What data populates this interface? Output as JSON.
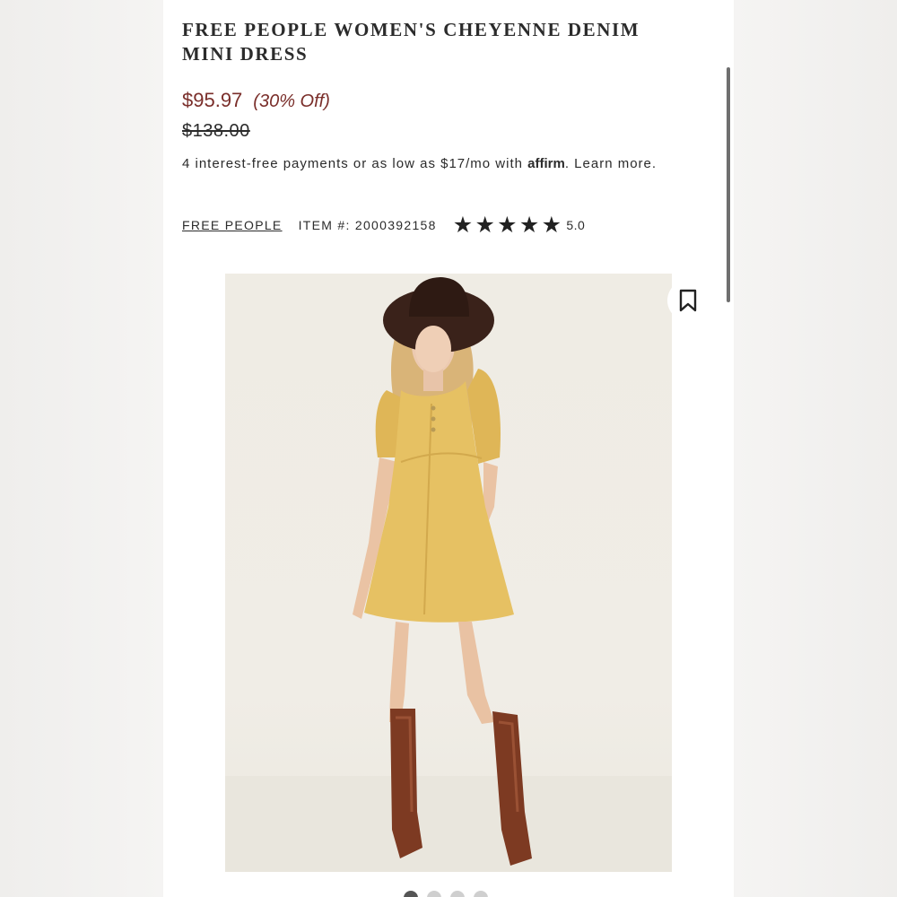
{
  "product": {
    "title": "FREE PEOPLE WOMEN'S CHEYENNE DENIM MINI DRESS",
    "sale_price": "$95.97",
    "discount": "(30% Off)",
    "original_price": "$138.00",
    "financing_text_before": "4 interest-free payments or as low as $17/mo with",
    "financing_logo": "affirm",
    "financing_text_after": ". Learn more.",
    "brand": "FREE PEOPLE",
    "item_number": "ITEM #: 2000392158",
    "rating": "5.0",
    "stars": 5
  },
  "icons": {
    "wishlist": "bookmark-icon",
    "star": "star-icon"
  },
  "carousel": {
    "slides": 4,
    "active": 1
  },
  "colors": {
    "price": "#7a2e2a",
    "dress": "#e6c163",
    "hat": "#3a221a",
    "boots": "#7d3a22"
  }
}
